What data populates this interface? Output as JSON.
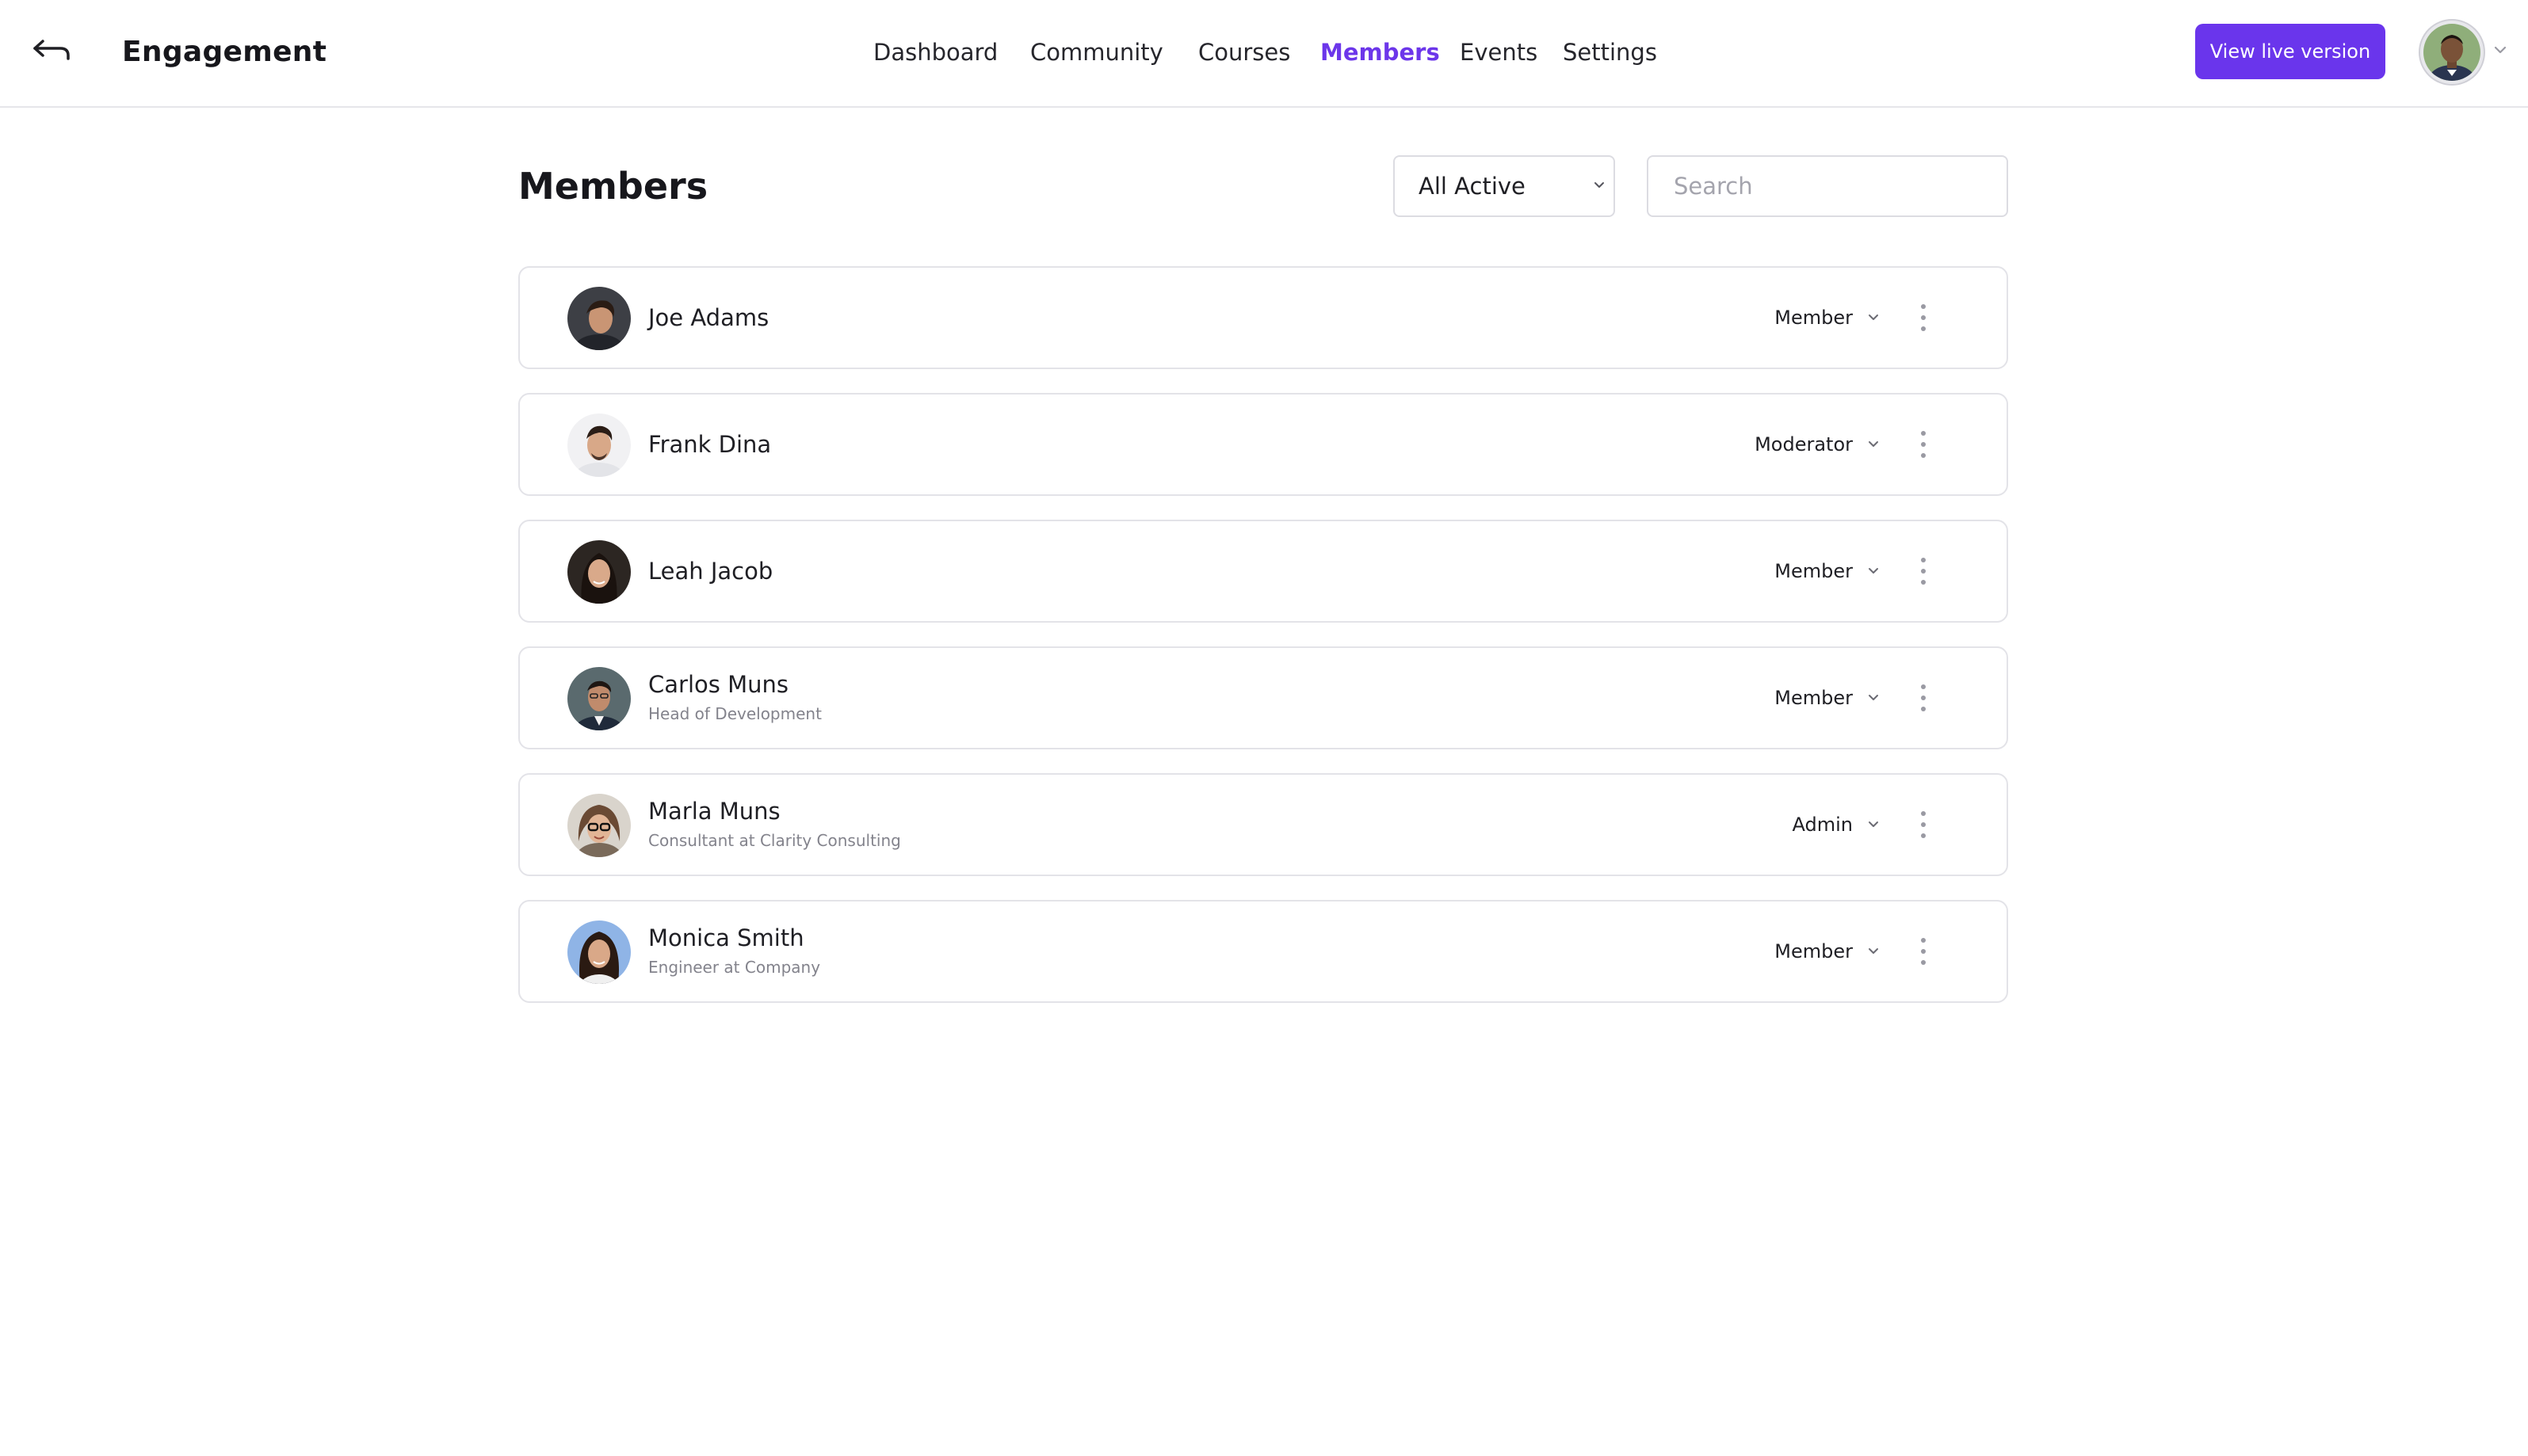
{
  "header": {
    "title": "Engagement",
    "nav": [
      {
        "label": "Dashboard",
        "active": false
      },
      {
        "label": "Community",
        "active": false
      },
      {
        "label": "Courses",
        "active": false
      },
      {
        "label": "Members",
        "active": true
      },
      {
        "label": "Events",
        "active": false
      },
      {
        "label": "Settings",
        "active": false
      }
    ],
    "live_button": "View live version",
    "accent_color": "#6a35ec"
  },
  "page": {
    "title": "Members",
    "filter": {
      "selected": "All Active"
    },
    "search": {
      "placeholder": "Search",
      "value": ""
    }
  },
  "members": [
    {
      "name": "Joe Adams",
      "subtitle": "",
      "role": "Member"
    },
    {
      "name": "Frank Dina",
      "subtitle": "",
      "role": "Moderator"
    },
    {
      "name": "Leah Jacob",
      "subtitle": "",
      "role": "Member"
    },
    {
      "name": "Carlos Muns",
      "subtitle": "Head of Development",
      "role": "Member"
    },
    {
      "name": "Marla Muns",
      "subtitle": "Consultant at Clarity Consulting",
      "role": "Admin"
    },
    {
      "name": "Monica Smith",
      "subtitle": "Engineer at Company",
      "role": "Member"
    }
  ]
}
